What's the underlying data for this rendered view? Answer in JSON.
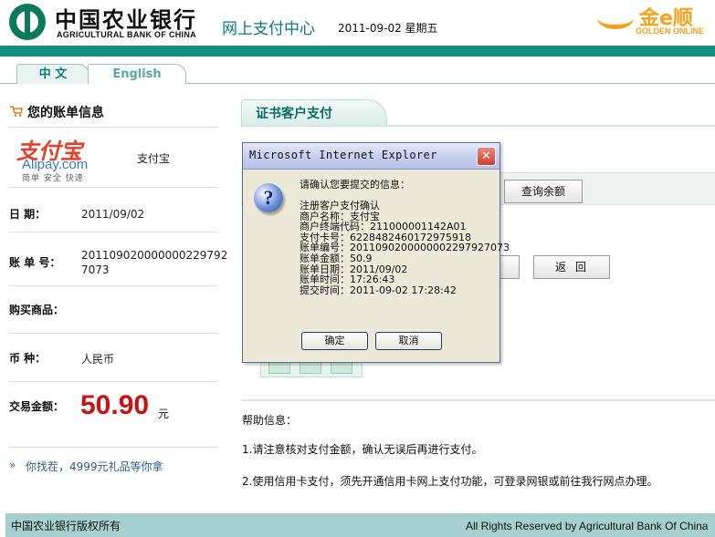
{
  "header": {
    "bank_name_cn": "中国农业银行",
    "bank_name_en": "AGRICULTURAL BANK OF CHINA",
    "center_title": "网上支付中心",
    "date": "2011-09-02 星期五",
    "golden_cn": "金e顺",
    "golden_en": "GOLDEN ONLINE"
  },
  "tabs": [
    {
      "label": "中 文",
      "active": true
    },
    {
      "label": "English",
      "active": false
    }
  ],
  "bill": {
    "title": "您的账单信息",
    "merchant_logo_cn": "支付宝",
    "merchant_logo_en": "Alipay.com",
    "merchant_slogan": "简单 安全 快速",
    "merchant_name": "支付宝",
    "date_label": "日 期：",
    "date_value": "2011/09/02",
    "bill_no_label": "账 单 号：",
    "bill_no_line1": "201109020000000229792",
    "bill_no_line2": "7073",
    "goods_label": "购买商品：",
    "goods_value": "",
    "currency_label": "币 种：",
    "currency_value": "人民币",
    "amount_label": "交易金额：",
    "amount_value": "50.90",
    "amount_unit": "元",
    "promo": "你找茬，4999元礼品等你拿"
  },
  "payment": {
    "tab_label": "证书客户支付",
    "query_balance": "查询余额",
    "back": "返回",
    "help_title": "帮助信息：",
    "help_1": "1.请注意核对支付金额，确认无误后再进行支付。",
    "help_2": "2.使用信用卡支付，须先开通信用卡网上支付功能，可登录网银或前往我行网点办理。"
  },
  "footer": {
    "left": "中国农业银行版权所有",
    "right": "All Rights Reserved by Agricultural Bank Of China"
  },
  "dialog": {
    "title": "Microsoft Internet Explorer",
    "prompt": "请确认您要提交的信息：",
    "lines": [
      "注册客户支付确认",
      "商户名称：支付宝",
      "商户终端代码：211000001142A01",
      "支付卡号：6228482460172975918",
      "账单编号：201109020000000229792707З",
      "账单金额：50.9",
      "账单日期：2011/09/02",
      "账单时间：17:26:43",
      "提交时间：2011-09-02 17:28:42"
    ],
    "ok": "确定",
    "cancel": "取消"
  },
  "colors": {
    "brand_teal": "#178f80",
    "amount_red": "#cc1111",
    "golden": "#f4a11c"
  }
}
